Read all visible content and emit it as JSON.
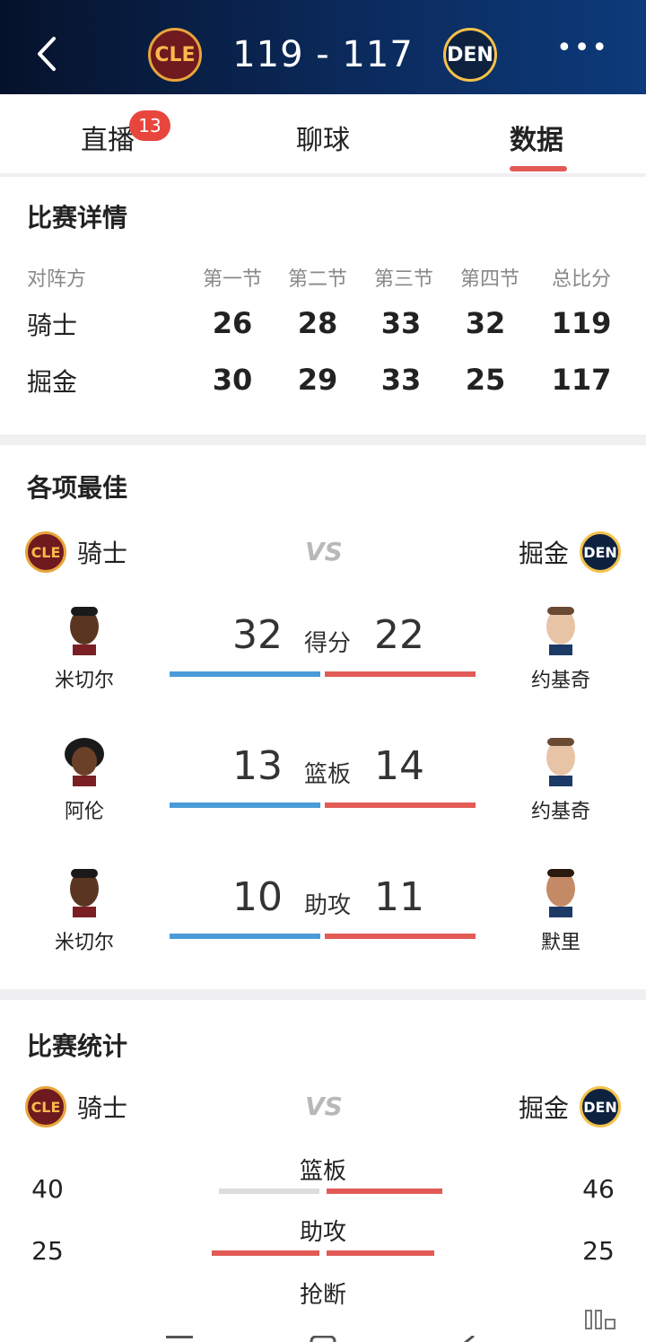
{
  "header": {
    "home_logo": "CLE",
    "away_logo": "DEN",
    "score": "119  -  117",
    "more": "•••"
  },
  "tabs": [
    {
      "label": "直播",
      "badge": "13"
    },
    {
      "label": "聊球"
    },
    {
      "label": "数据"
    }
  ],
  "details": {
    "title": "比赛详情",
    "headers": [
      "对阵方",
      "第一节",
      "第二节",
      "第三节",
      "第四节",
      "总比分"
    ],
    "rows": [
      {
        "team": "骑士",
        "scores": [
          "26",
          "28",
          "33",
          "32",
          "119"
        ]
      },
      {
        "team": "掘金",
        "scores": [
          "30",
          "29",
          "33",
          "25",
          "117"
        ]
      }
    ]
  },
  "leaders": {
    "title": "各项最佳",
    "home_team": "骑士",
    "away_team": "掘金",
    "vs": "VS",
    "items": [
      {
        "category": "得分",
        "home_player": "米切尔",
        "home_value": "32",
        "away_player": "约基奇",
        "away_value": "22"
      },
      {
        "category": "篮板",
        "home_player": "阿伦",
        "home_value": "13",
        "away_player": "约基奇",
        "away_value": "14"
      },
      {
        "category": "助攻",
        "home_player": "米切尔",
        "home_value": "10",
        "away_player": "默里",
        "away_value": "11"
      }
    ]
  },
  "stats": {
    "title": "比赛统计",
    "home_team": "骑士",
    "away_team": "掘金",
    "vs": "VS",
    "items": [
      {
        "category": "篮板",
        "home": "40",
        "away": "46"
      },
      {
        "category": "助攻",
        "home": "25",
        "away": "25"
      },
      {
        "category": "抢断"
      }
    ]
  },
  "colors": {
    "accent": "#e25b56",
    "home_bar": "#4a9bd8",
    "header_bg": "#0b2a5c"
  }
}
